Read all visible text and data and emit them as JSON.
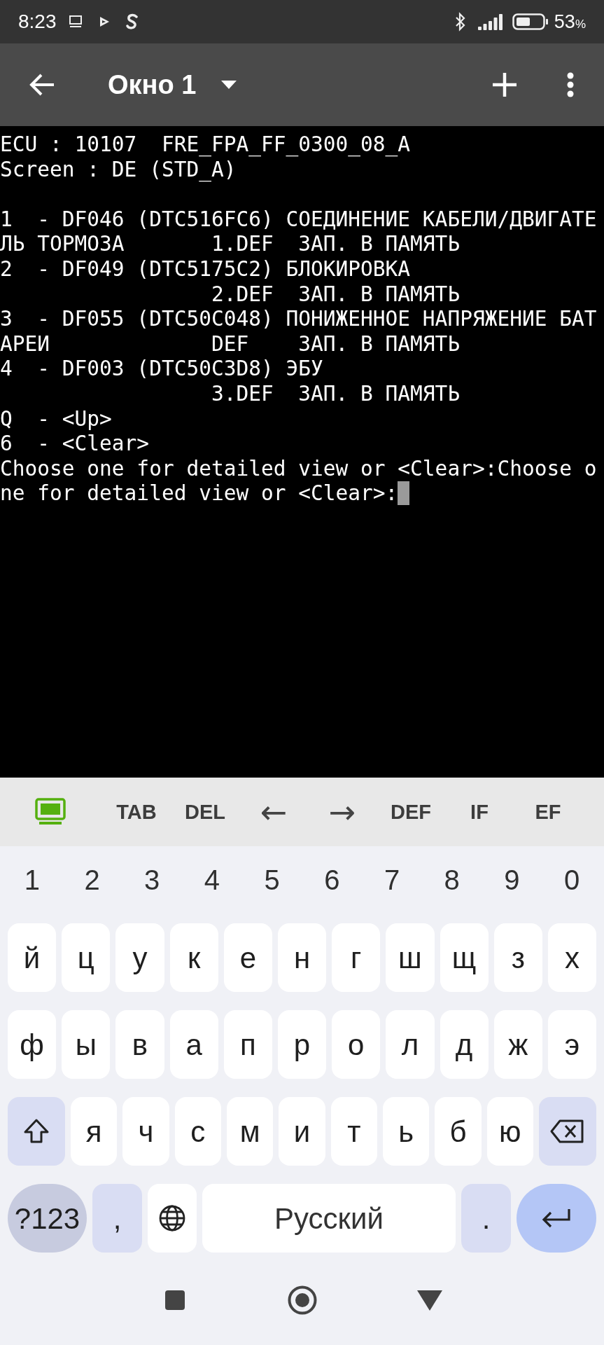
{
  "status_bar": {
    "time": "8:23",
    "battery": "53",
    "battery_unit": "%"
  },
  "app_bar": {
    "title": "Окно 1"
  },
  "terminal": {
    "blocks": [
      [
        "ECU : 10107  FRE_FPA_FF_0300_08_A",
        "Screen : DE (STD_A)"
      ],
      [
        "1  - DF046 (DTC516FC6) СОЕДИНЕНИЕ КАБЕЛИ/ДВИГАТЕ",
        "ЛЬ ТОРМОЗА       1.DEF  ЗАП. В ПАМЯТЬ",
        "2  - DF049 (DTC5175C2) БЛОКИРОВКА",
        "                 2.DEF  ЗАП. В ПАМЯТЬ",
        "3  - DF055 (DTC50C048) ПОНИЖЕННОЕ НАПРЯЖЕНИЕ БАТ",
        "АРЕИ             DEF    ЗАП. В ПАМЯТЬ",
        "4  - DF003 (DTC50C3D8) ЭБУ",
        "                 3.DEF  ЗАП. В ПАМЯТЬ",
        "Q  - <Up>",
        "6  - <Clear>",
        "Choose one for detailed view or <Clear>:Choose o",
        "ne for detailed view or <Clear>:"
      ]
    ],
    "cursor": true
  },
  "extra_keys": [
    {
      "kind": "toggle"
    },
    {
      "kind": "key",
      "label": "TAB"
    },
    {
      "kind": "key",
      "label": "DEL"
    },
    {
      "kind": "arrow",
      "label": "←"
    },
    {
      "kind": "arrow",
      "label": "→"
    },
    {
      "kind": "key",
      "label": "DEF"
    },
    {
      "kind": "key",
      "label": "IF"
    },
    {
      "kind": "key",
      "label": "EF"
    }
  ],
  "keyboard": {
    "number_row": [
      "1",
      "2",
      "3",
      "4",
      "5",
      "6",
      "7",
      "8",
      "9",
      "0"
    ],
    "rows": [
      [
        {
          "kind": "letter",
          "label": "й"
        },
        {
          "kind": "letter",
          "label": "ц"
        },
        {
          "kind": "letter",
          "label": "у"
        },
        {
          "kind": "letter",
          "label": "к"
        },
        {
          "kind": "letter",
          "label": "е"
        },
        {
          "kind": "letter",
          "label": "н"
        },
        {
          "kind": "letter",
          "label": "г"
        },
        {
          "kind": "letter",
          "label": "ш"
        },
        {
          "kind": "letter",
          "label": "щ"
        },
        {
          "kind": "letter",
          "label": "з"
        },
        {
          "kind": "letter",
          "label": "х"
        }
      ],
      [
        {
          "kind": "letter",
          "label": "ф"
        },
        {
          "kind": "letter",
          "label": "ы"
        },
        {
          "kind": "letter",
          "label": "в"
        },
        {
          "kind": "letter",
          "label": "а"
        },
        {
          "kind": "letter",
          "label": "п"
        },
        {
          "kind": "letter",
          "label": "р"
        },
        {
          "kind": "letter",
          "label": "о"
        },
        {
          "kind": "letter",
          "label": "л"
        },
        {
          "kind": "letter",
          "label": "д"
        },
        {
          "kind": "letter",
          "label": "ж"
        },
        {
          "kind": "letter",
          "label": "э"
        }
      ],
      [
        {
          "kind": "shift"
        },
        {
          "kind": "letter",
          "label": "я"
        },
        {
          "kind": "letter",
          "label": "ч"
        },
        {
          "kind": "letter",
          "label": "с"
        },
        {
          "kind": "letter",
          "label": "м"
        },
        {
          "kind": "letter",
          "label": "и"
        },
        {
          "kind": "letter",
          "label": "т"
        },
        {
          "kind": "letter",
          "label": "ь"
        },
        {
          "kind": "letter",
          "label": "б"
        },
        {
          "kind": "letter",
          "label": "ю"
        },
        {
          "kind": "backspace"
        }
      ]
    ],
    "bottom_row": [
      {
        "kind": "symbols",
        "label": "?123"
      },
      {
        "kind": "punct",
        "label": ","
      },
      {
        "kind": "globe"
      },
      {
        "kind": "space",
        "label": "Русский"
      },
      {
        "kind": "punct",
        "label": "."
      },
      {
        "kind": "enter"
      }
    ]
  }
}
